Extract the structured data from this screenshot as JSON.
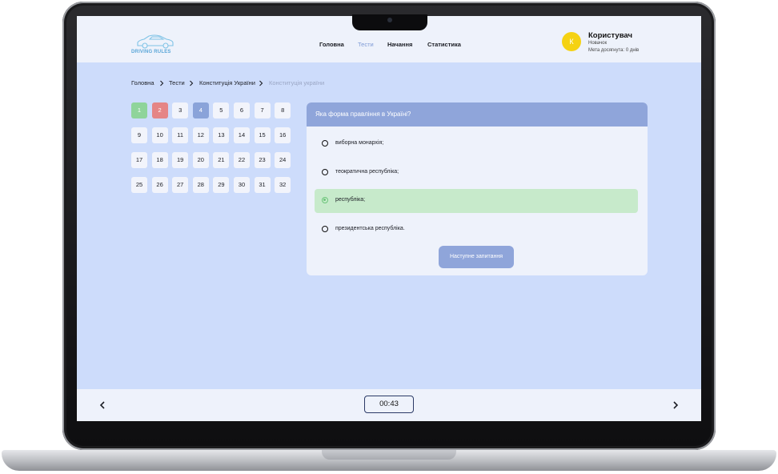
{
  "brand": {
    "logo_text": "DRIVING RULES",
    "icon": "car-icon",
    "accent": "#5aa6d8"
  },
  "nav": [
    {
      "label": "Головна",
      "active": false
    },
    {
      "label": "Тести",
      "active": true
    },
    {
      "label": "Начання",
      "active": false
    },
    {
      "label": "Статистика",
      "active": false
    }
  ],
  "user": {
    "initial": "К",
    "name": "Користувач",
    "level": "Новачок",
    "goal": "Мета досягнута: 0 днів",
    "avatar_color": "#f5d213"
  },
  "breadcrumb": [
    {
      "label": "Головна"
    },
    {
      "label": "Тести"
    },
    {
      "label": "Конституція України"
    },
    {
      "label": "Конституція україни"
    }
  ],
  "question_numbers": [
    {
      "label": "1",
      "state": "correct"
    },
    {
      "label": "2",
      "state": "wrong"
    },
    {
      "label": "3",
      "state": "default"
    },
    {
      "label": "4",
      "state": "current"
    },
    {
      "label": "5",
      "state": "default"
    },
    {
      "label": "6",
      "state": "default"
    },
    {
      "label": "7",
      "state": "default"
    },
    {
      "label": "8",
      "state": "default"
    },
    {
      "label": "9",
      "state": "default"
    },
    {
      "label": "10",
      "state": "default"
    },
    {
      "label": "11",
      "state": "default"
    },
    {
      "label": "12",
      "state": "default"
    },
    {
      "label": "13",
      "state": "default"
    },
    {
      "label": "14",
      "state": "default"
    },
    {
      "label": "15",
      "state": "default"
    },
    {
      "label": "16",
      "state": "default"
    },
    {
      "label": "17",
      "state": "default"
    },
    {
      "label": "18",
      "state": "default"
    },
    {
      "label": "19",
      "state": "default"
    },
    {
      "label": "20",
      "state": "default"
    },
    {
      "label": "21",
      "state": "default"
    },
    {
      "label": "22",
      "state": "default"
    },
    {
      "label": "23",
      "state": "default"
    },
    {
      "label": "24",
      "state": "default"
    },
    {
      "label": "25",
      "state": "default"
    },
    {
      "label": "26",
      "state": "default"
    },
    {
      "label": "27",
      "state": "default"
    },
    {
      "label": "28",
      "state": "default"
    },
    {
      "label": "29",
      "state": "default"
    },
    {
      "label": "30",
      "state": "default"
    },
    {
      "label": "31",
      "state": "default"
    },
    {
      "label": "32",
      "state": "default"
    }
  ],
  "question": {
    "text": "Яка форма правління в Україні?",
    "answers": [
      {
        "text": "виборна монархія;",
        "correct": false
      },
      {
        "text": "теократична республіка;",
        "correct": false
      },
      {
        "text": "республіка;",
        "correct": true
      },
      {
        "text": "президентська республіка.",
        "correct": false
      }
    ],
    "next_label": "Наступне запитання"
  },
  "footer": {
    "timer": "00:43",
    "prev_icon": "chevron-left-icon",
    "next_icon": "chevron-right-icon"
  },
  "colors": {
    "background": "#cddcfb",
    "panel": "#eef2fb",
    "header_accent": "#8fa5da",
    "correct": "#8fd49a",
    "wrong": "#e58585",
    "current": "#8aa3d9",
    "correct_answer_bg": "#c7eacb"
  }
}
